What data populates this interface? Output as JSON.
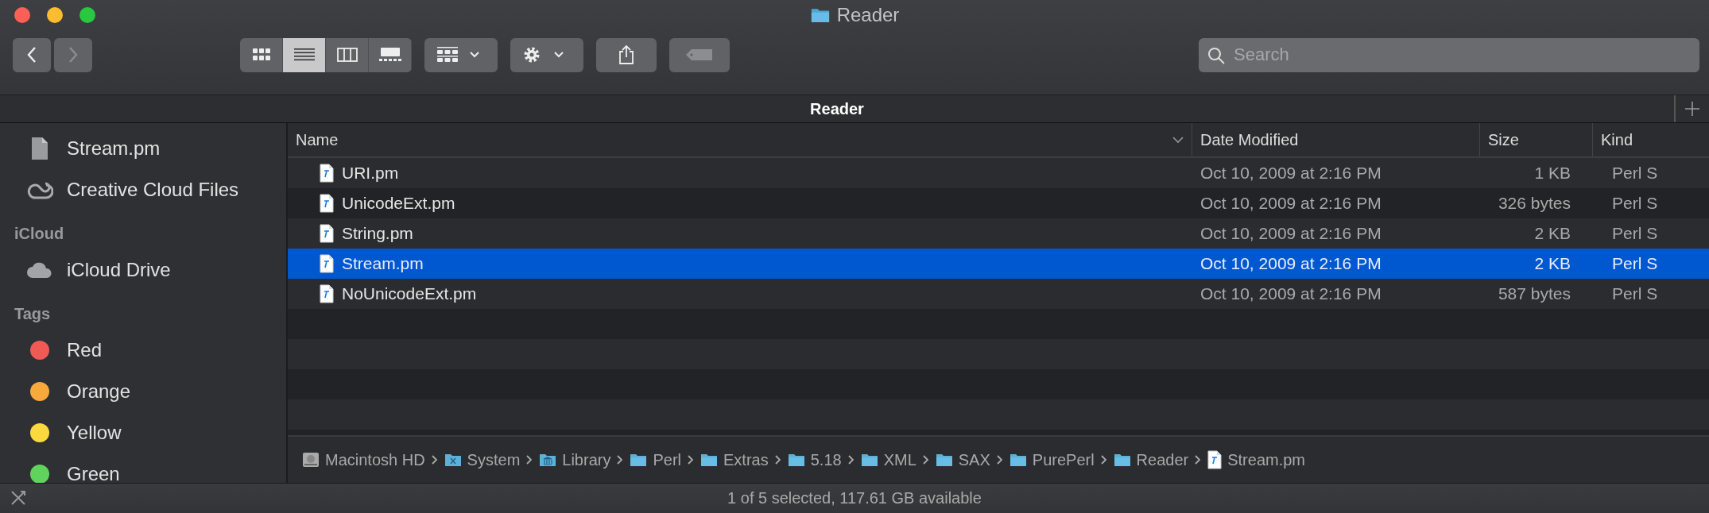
{
  "window": {
    "title": "Reader"
  },
  "toolbar": {
    "back": {
      "disabled": false
    },
    "forward": {
      "disabled": true
    },
    "view_modes": [
      {
        "kind": "icons",
        "selected": false
      },
      {
        "kind": "list",
        "selected": true
      },
      {
        "kind": "columns",
        "selected": false
      },
      {
        "kind": "gallery",
        "selected": false
      }
    ],
    "search": {
      "placeholder": "Search"
    }
  },
  "tabs": [
    {
      "label": "Reader",
      "selected": true
    }
  ],
  "sidebar": {
    "sections": [
      {
        "items": [
          {
            "label": "Stream.pm",
            "kind": "file"
          },
          {
            "label": "Creative Cloud Files",
            "kind": "cloud-ring"
          }
        ]
      },
      {
        "header": "iCloud",
        "items": [
          {
            "label": "iCloud Drive",
            "kind": "cloud"
          }
        ]
      },
      {
        "header": "Tags",
        "items": [
          {
            "label": "Red",
            "kind": "tag",
            "color": "#f05a55"
          },
          {
            "label": "Orange",
            "kind": "tag",
            "color": "#f8a93b"
          },
          {
            "label": "Yellow",
            "kind": "tag",
            "color": "#f9d93e"
          },
          {
            "label": "Green",
            "kind": "tag",
            "color": "#5fd35c"
          }
        ]
      }
    ]
  },
  "table": {
    "columns": [
      {
        "label": "Name",
        "sorted": true
      },
      {
        "label": "Date Modified",
        "sorted": false
      },
      {
        "label": "Size",
        "sorted": false
      },
      {
        "label": "Kind",
        "sorted": false
      }
    ],
    "rows": [
      {
        "name": "URI.pm",
        "date": "Oct 10, 2009 at 2:16 PM",
        "size": "1 KB",
        "kind": "Perl S",
        "selected": false
      },
      {
        "name": "UnicodeExt.pm",
        "date": "Oct 10, 2009 at 2:16 PM",
        "size": "326 bytes",
        "kind": "Perl S",
        "selected": false
      },
      {
        "name": "String.pm",
        "date": "Oct 10, 2009 at 2:16 PM",
        "size": "2 KB",
        "kind": "Perl S",
        "selected": false
      },
      {
        "name": "Stream.pm",
        "date": "Oct 10, 2009 at 2:16 PM",
        "size": "2 KB",
        "kind": "Perl S",
        "selected": true
      },
      {
        "name": "NoUnicodeExt.pm",
        "date": "Oct 10, 2009 at 2:16 PM",
        "size": "587 bytes",
        "kind": "Perl S",
        "selected": false
      }
    ]
  },
  "path_bar": [
    {
      "label": "Macintosh HD",
      "kind": "disk"
    },
    {
      "label": "System",
      "kind": "system-folder"
    },
    {
      "label": "Library",
      "kind": "library-folder"
    },
    {
      "label": "Perl",
      "kind": "folder"
    },
    {
      "label": "Extras",
      "kind": "folder"
    },
    {
      "label": "5.18",
      "kind": "folder"
    },
    {
      "label": "XML",
      "kind": "folder"
    },
    {
      "label": "SAX",
      "kind": "folder"
    },
    {
      "label": "PurePerl",
      "kind": "folder"
    },
    {
      "label": "Reader",
      "kind": "folder"
    },
    {
      "label": "Stream.pm",
      "kind": "file"
    }
  ],
  "status_bar": {
    "text": "1 of 5 selected, 117.61 GB available"
  }
}
